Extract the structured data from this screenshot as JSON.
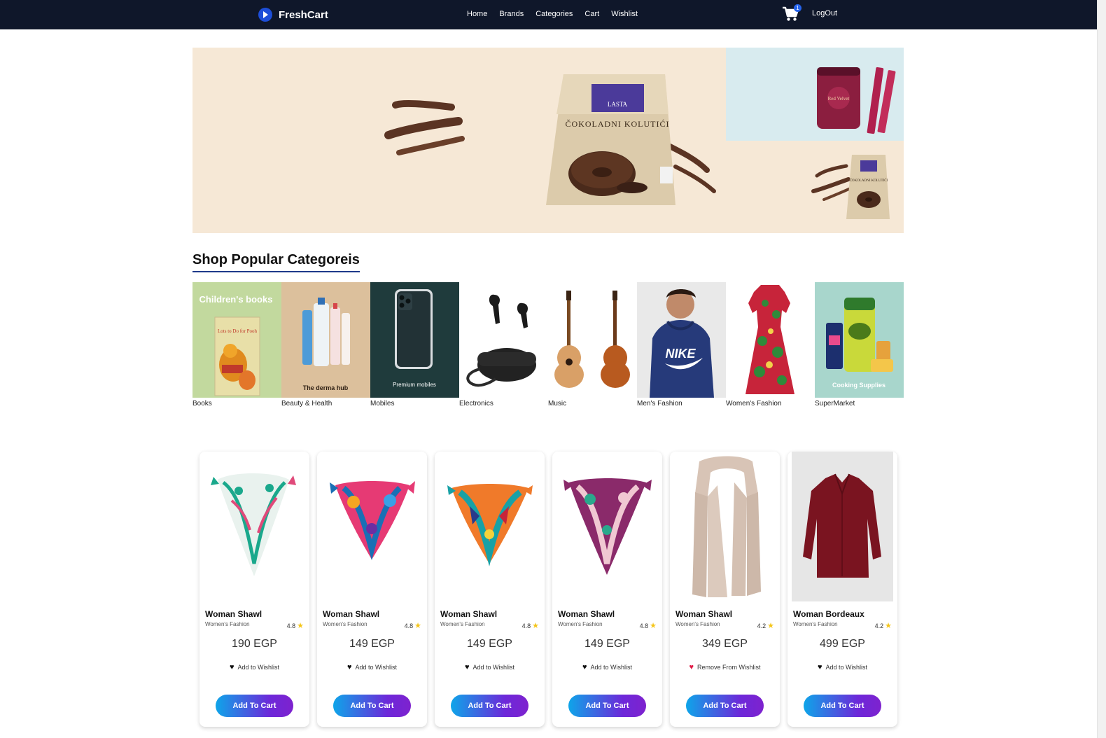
{
  "navbar": {
    "brand": "FreshCart",
    "links": [
      "Home",
      "Brands",
      "Categories",
      "Cart",
      "Wishlist"
    ],
    "cart_count": "1",
    "logout": "LogOut"
  },
  "slider": {
    "main_bag_brand": "LASTA",
    "main_bag_text": "ČOKOLADNI KOLUTIĆI",
    "side_top_product": "Red Velvet",
    "side_bottom_bag_text": "ČOKOLADNI KOLUTIĆI"
  },
  "categories": {
    "title": "Shop Popular Categoreis",
    "items": [
      {
        "label": "Books",
        "img_text": "Children's books",
        "img_subtext": "Lots to Do for Pooh"
      },
      {
        "label": "Beauty & Health",
        "img_text": "The derma hub"
      },
      {
        "label": "Mobiles",
        "img_text": "Premium mobiles"
      },
      {
        "label": "Electronics"
      },
      {
        "label": "Music"
      },
      {
        "label": "Men's Fashion",
        "img_text": "NIKE"
      },
      {
        "label": "Women's Fashion"
      },
      {
        "label": "SuperMarket",
        "img_text": "Cooking Supplies"
      }
    ]
  },
  "products": [
    {
      "title": "Woman Shawl",
      "category": "Women's Fashion",
      "rating": "4.8",
      "price": "190 EGP",
      "wishlist": "Add to Wishlist",
      "in_wishlist": false,
      "button": "Add To Cart"
    },
    {
      "title": "Woman Shawl",
      "category": "Women's Fashion",
      "rating": "4.8",
      "price": "149 EGP",
      "wishlist": "Add to Wishlist",
      "in_wishlist": false,
      "button": "Add To Cart"
    },
    {
      "title": "Woman Shawl",
      "category": "Women's Fashion",
      "rating": "4.8",
      "price": "149 EGP",
      "wishlist": "Add to Wishlist",
      "in_wishlist": false,
      "button": "Add To Cart"
    },
    {
      "title": "Woman Shawl",
      "category": "Women's Fashion",
      "rating": "4.8",
      "price": "149 EGP",
      "wishlist": "Add to Wishlist",
      "in_wishlist": false,
      "button": "Add To Cart"
    },
    {
      "title": "Woman Shawl",
      "category": "Women's Fashion",
      "rating": "4.2",
      "price": "349 EGP",
      "wishlist": "Remove From Wishlist",
      "in_wishlist": true,
      "button": "Add To Cart"
    },
    {
      "title": "Woman Bordeaux",
      "category": "Women's Fashion",
      "rating": "4.2",
      "price": "499 EGP",
      "wishlist": "Add to Wishlist",
      "in_wishlist": false,
      "button": "Add To Cart"
    }
  ],
  "colors": {
    "navbar": "#0f172a",
    "accent_blue": "#2563eb",
    "button_start": "#0ea5e9",
    "button_end": "#7e22ce",
    "star": "#f5c518",
    "heart_active": "#e11d48"
  }
}
